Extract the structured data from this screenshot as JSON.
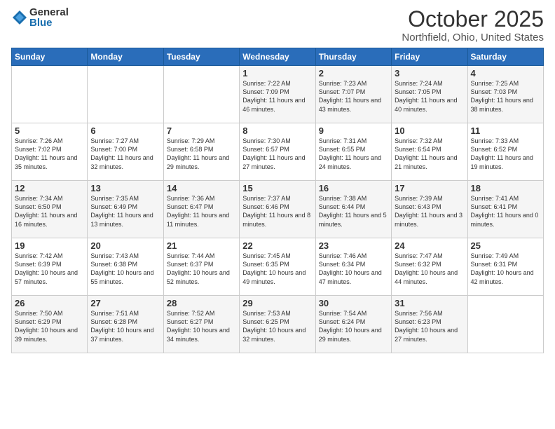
{
  "logo": {
    "general": "General",
    "blue": "Blue"
  },
  "header": {
    "title": "October 2025",
    "subtitle": "Northfield, Ohio, United States"
  },
  "days_of_week": [
    "Sunday",
    "Monday",
    "Tuesday",
    "Wednesday",
    "Thursday",
    "Friday",
    "Saturday"
  ],
  "weeks": [
    [
      {
        "day": "",
        "info": ""
      },
      {
        "day": "",
        "info": ""
      },
      {
        "day": "",
        "info": ""
      },
      {
        "day": "1",
        "info": "Sunrise: 7:22 AM\nSunset: 7:09 PM\nDaylight: 11 hours and 46 minutes."
      },
      {
        "day": "2",
        "info": "Sunrise: 7:23 AM\nSunset: 7:07 PM\nDaylight: 11 hours and 43 minutes."
      },
      {
        "day": "3",
        "info": "Sunrise: 7:24 AM\nSunset: 7:05 PM\nDaylight: 11 hours and 40 minutes."
      },
      {
        "day": "4",
        "info": "Sunrise: 7:25 AM\nSunset: 7:03 PM\nDaylight: 11 hours and 38 minutes."
      }
    ],
    [
      {
        "day": "5",
        "info": "Sunrise: 7:26 AM\nSunset: 7:02 PM\nDaylight: 11 hours and 35 minutes."
      },
      {
        "day": "6",
        "info": "Sunrise: 7:27 AM\nSunset: 7:00 PM\nDaylight: 11 hours and 32 minutes."
      },
      {
        "day": "7",
        "info": "Sunrise: 7:29 AM\nSunset: 6:58 PM\nDaylight: 11 hours and 29 minutes."
      },
      {
        "day": "8",
        "info": "Sunrise: 7:30 AM\nSunset: 6:57 PM\nDaylight: 11 hours and 27 minutes."
      },
      {
        "day": "9",
        "info": "Sunrise: 7:31 AM\nSunset: 6:55 PM\nDaylight: 11 hours and 24 minutes."
      },
      {
        "day": "10",
        "info": "Sunrise: 7:32 AM\nSunset: 6:54 PM\nDaylight: 11 hours and 21 minutes."
      },
      {
        "day": "11",
        "info": "Sunrise: 7:33 AM\nSunset: 6:52 PM\nDaylight: 11 hours and 19 minutes."
      }
    ],
    [
      {
        "day": "12",
        "info": "Sunrise: 7:34 AM\nSunset: 6:50 PM\nDaylight: 11 hours and 16 minutes."
      },
      {
        "day": "13",
        "info": "Sunrise: 7:35 AM\nSunset: 6:49 PM\nDaylight: 11 hours and 13 minutes."
      },
      {
        "day": "14",
        "info": "Sunrise: 7:36 AM\nSunset: 6:47 PM\nDaylight: 11 hours and 11 minutes."
      },
      {
        "day": "15",
        "info": "Sunrise: 7:37 AM\nSunset: 6:46 PM\nDaylight: 11 hours and 8 minutes."
      },
      {
        "day": "16",
        "info": "Sunrise: 7:38 AM\nSunset: 6:44 PM\nDaylight: 11 hours and 5 minutes."
      },
      {
        "day": "17",
        "info": "Sunrise: 7:39 AM\nSunset: 6:43 PM\nDaylight: 11 hours and 3 minutes."
      },
      {
        "day": "18",
        "info": "Sunrise: 7:41 AM\nSunset: 6:41 PM\nDaylight: 11 hours and 0 minutes."
      }
    ],
    [
      {
        "day": "19",
        "info": "Sunrise: 7:42 AM\nSunset: 6:39 PM\nDaylight: 10 hours and 57 minutes."
      },
      {
        "day": "20",
        "info": "Sunrise: 7:43 AM\nSunset: 6:38 PM\nDaylight: 10 hours and 55 minutes."
      },
      {
        "day": "21",
        "info": "Sunrise: 7:44 AM\nSunset: 6:37 PM\nDaylight: 10 hours and 52 minutes."
      },
      {
        "day": "22",
        "info": "Sunrise: 7:45 AM\nSunset: 6:35 PM\nDaylight: 10 hours and 49 minutes."
      },
      {
        "day": "23",
        "info": "Sunrise: 7:46 AM\nSunset: 6:34 PM\nDaylight: 10 hours and 47 minutes."
      },
      {
        "day": "24",
        "info": "Sunrise: 7:47 AM\nSunset: 6:32 PM\nDaylight: 10 hours and 44 minutes."
      },
      {
        "day": "25",
        "info": "Sunrise: 7:49 AM\nSunset: 6:31 PM\nDaylight: 10 hours and 42 minutes."
      }
    ],
    [
      {
        "day": "26",
        "info": "Sunrise: 7:50 AM\nSunset: 6:29 PM\nDaylight: 10 hours and 39 minutes."
      },
      {
        "day": "27",
        "info": "Sunrise: 7:51 AM\nSunset: 6:28 PM\nDaylight: 10 hours and 37 minutes."
      },
      {
        "day": "28",
        "info": "Sunrise: 7:52 AM\nSunset: 6:27 PM\nDaylight: 10 hours and 34 minutes."
      },
      {
        "day": "29",
        "info": "Sunrise: 7:53 AM\nSunset: 6:25 PM\nDaylight: 10 hours and 32 minutes."
      },
      {
        "day": "30",
        "info": "Sunrise: 7:54 AM\nSunset: 6:24 PM\nDaylight: 10 hours and 29 minutes."
      },
      {
        "day": "31",
        "info": "Sunrise: 7:56 AM\nSunset: 6:23 PM\nDaylight: 10 hours and 27 minutes."
      },
      {
        "day": "",
        "info": ""
      }
    ]
  ]
}
